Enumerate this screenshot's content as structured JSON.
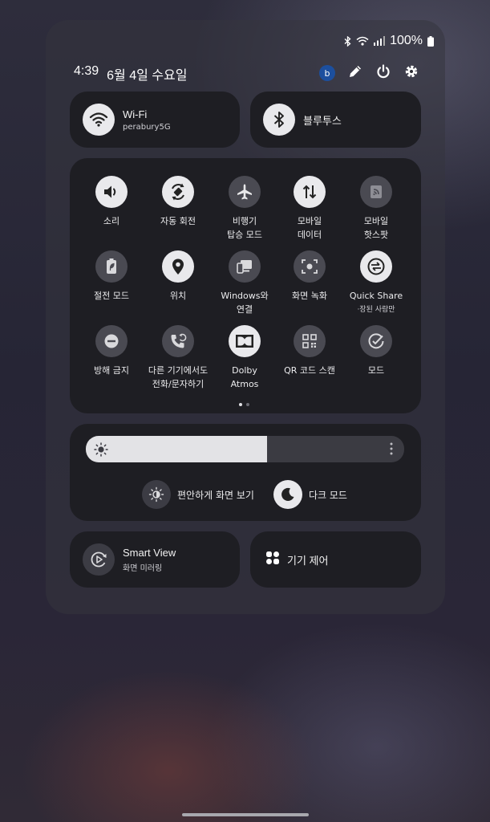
{
  "status_bar": {
    "battery": "100%"
  },
  "header": {
    "time": "4:39",
    "date": "6월 4일 수요일",
    "avatar_letter": "b"
  },
  "top_tiles": {
    "wifi": {
      "title": "Wi-Fi",
      "subtitle": "perabury5G",
      "icon": "wifi-icon"
    },
    "bluetooth": {
      "title": "블루투스",
      "icon": "bluetooth-icon"
    }
  },
  "quick_settings": [
    {
      "label": "소리",
      "icon": "sound-icon",
      "on": true
    },
    {
      "label": "자동 회전",
      "icon": "auto-rotate-icon",
      "on": true
    },
    {
      "label": "비행기\n탑승 모드",
      "icon": "airplane-icon",
      "on": false
    },
    {
      "label": "모바일\n데이터",
      "icon": "mobile-data-icon",
      "on": true
    },
    {
      "label": "모바일\n핫스팟",
      "icon": "hotspot-icon",
      "on": false
    },
    {
      "label": "절전 모드",
      "icon": "power-saving-icon",
      "on": false
    },
    {
      "label": "위치",
      "icon": "location-icon",
      "on": true
    },
    {
      "label": "Windows와\n연결",
      "icon": "link-windows-icon",
      "on": false
    },
    {
      "label": "화면 녹화",
      "icon": "screen-record-icon",
      "on": false
    },
    {
      "label": "Quick Share",
      "sublabel": "·장된 사람만",
      "icon": "quick-share-icon",
      "on": true
    },
    {
      "label": "방해 금지",
      "icon": "do-not-disturb-icon",
      "on": false
    },
    {
      "label": "다른 기기에서도\n전화/문자하기",
      "icon": "call-other-devices-icon",
      "on": false
    },
    {
      "label": "Dolby\nAtmos",
      "icon": "dolby-icon",
      "on": true
    },
    {
      "label": "QR 코드 스캔",
      "icon": "qr-scan-icon",
      "on": false
    },
    {
      "label": "모드",
      "icon": "modes-icon",
      "on": false
    }
  ],
  "page_indicator": {
    "pages": 2,
    "current": 1
  },
  "brightness": {
    "level_percent": 57
  },
  "display_options": {
    "eye_comfort": "편안하게 화면 보기",
    "dark_mode": "다크 모드"
  },
  "bottom_tiles": {
    "smart_view": {
      "title": "Smart View",
      "subtitle": "화면 미러링"
    },
    "device_control": {
      "title": "기기 제어"
    }
  },
  "colors": {
    "active_circle": "#e9e9ec",
    "card_bg": "#1e1e23",
    "avatar": "#1c4f9e"
  }
}
